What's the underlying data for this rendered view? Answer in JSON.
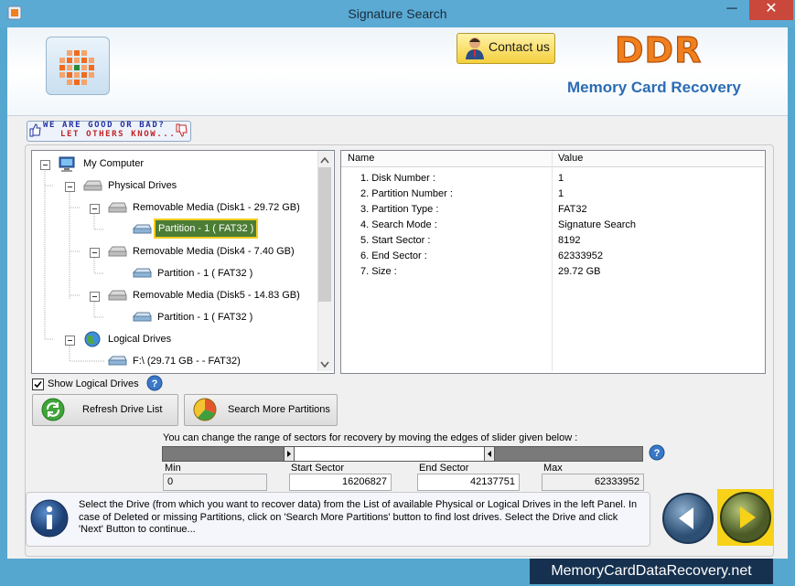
{
  "window": {
    "title": "Signature Search",
    "minimize_glyph": "─",
    "close_glyph": "✕"
  },
  "header": {
    "contact_label": "Contact us",
    "brand": "DDR",
    "product": "Memory Card Recovery"
  },
  "banner": {
    "line1": "WE ARE GOOD OR BAD?",
    "line2": "LET OTHERS KNOW..."
  },
  "tree": {
    "root": "My Computer",
    "physical": "Physical Drives",
    "disks": [
      {
        "label": "Removable Media (Disk1 - 29.72 GB)",
        "partition": "Partition - 1 ( FAT32 )"
      },
      {
        "label": "Removable Media (Disk4 - 7.40 GB)",
        "partition": "Partition - 1 ( FAT32 )"
      },
      {
        "label": "Removable Media (Disk5 - 14.83 GB)",
        "partition": "Partition - 1 ( FAT32 )"
      }
    ],
    "logical": "Logical Drives",
    "logical_items": [
      {
        "label": "F:\\ (29.71 GB -  - FAT32)"
      }
    ]
  },
  "properties": {
    "columns": {
      "name": "Name",
      "value": "Value"
    },
    "rows": [
      {
        "name": "1. Disk Number :",
        "value": "1"
      },
      {
        "name": "2. Partition Number :",
        "value": "1"
      },
      {
        "name": "3. Partition Type :",
        "value": "FAT32"
      },
      {
        "name": "4. Search Mode :",
        "value": "Signature Search"
      },
      {
        "name": "5. Start Sector :",
        "value": "8192"
      },
      {
        "name": "6. End Sector :",
        "value": "62333952"
      },
      {
        "name": "7. Size :",
        "value": "29.72 GB"
      }
    ]
  },
  "controls": {
    "show_logical": "Show Logical Drives",
    "show_logical_checked": true,
    "refresh": "Refresh Drive List",
    "search_more": "Search More Partitions",
    "help": "?"
  },
  "range": {
    "hint": "You can change the range of sectors for recovery by moving the edges of slider given below :",
    "selection_start_fraction": 0.26,
    "selection_end_fraction": 0.676,
    "min_label": "Min",
    "min_value": "0",
    "start_label": "Start Sector",
    "start_value": "16206827",
    "end_label": "End Sector",
    "end_value": "42137751",
    "max_label": "Max",
    "max_value": "62333952"
  },
  "info": {
    "text": "Select the Drive (from which you want to recover data) from the List of available Physical or Logical Drives in the left Panel. In case of Deleted or missing Partitions, click on 'Search More Partitions' button to find lost drives. Select the Drive and click 'Next' Button to continue..."
  },
  "footer": {
    "url": "MemoryCardDataRecovery.net"
  },
  "icons": {
    "info": "info-icon",
    "back": "back-arrow-icon",
    "next": "next-arrow-icon"
  }
}
